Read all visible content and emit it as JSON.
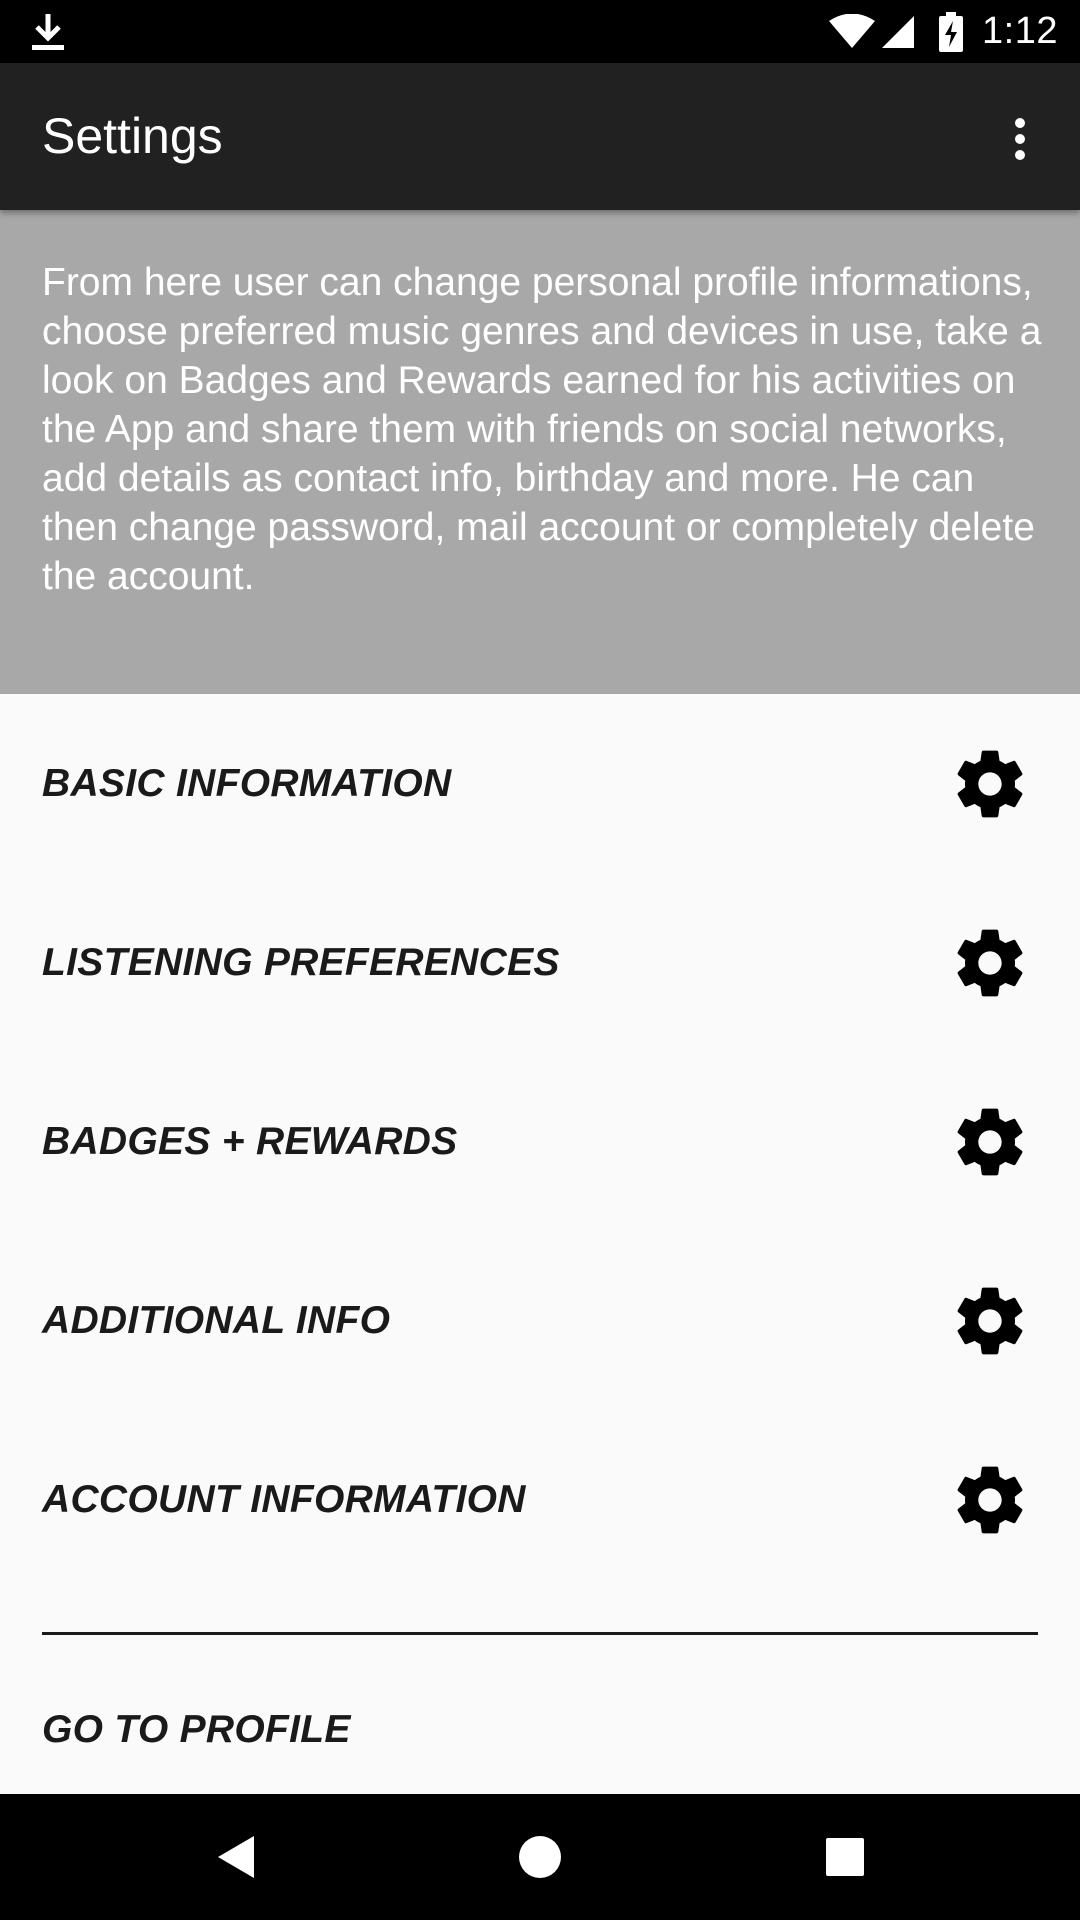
{
  "status_bar": {
    "time": "1:12",
    "icons": [
      "download-icon",
      "wifi-icon",
      "signal-icon",
      "battery-charging-icon"
    ]
  },
  "app_bar": {
    "title": "Settings",
    "overflow_icon": "more-vert-icon"
  },
  "description": "From here user can change personal profile informations, choose preferred music genres and devices in use, take a look on Badges and Rewards earned for his activities on the App and share them with friends on social networks, add details as contact info, birthday and more. He can then change password, mail account or completely delete the account.",
  "settings": {
    "items": [
      {
        "label": "BASIC INFORMATION",
        "icon": "gear-icon"
      },
      {
        "label": "LISTENING PREFERENCES",
        "icon": "gear-icon"
      },
      {
        "label": "BADGES + REWARDS",
        "icon": "gear-icon"
      },
      {
        "label": "ADDITIONAL INFO",
        "icon": "gear-icon"
      },
      {
        "label": "ACCOUNT INFORMATION",
        "icon": "gear-icon"
      }
    ],
    "profile_link": "GO TO PROFILE"
  },
  "nav_bar": {
    "icons": [
      "back-icon",
      "home-icon",
      "recents-icon"
    ]
  },
  "colors": {
    "status_bar": "#000000",
    "app_bar": "#212121",
    "description_bg": "#a8a8a8",
    "list_bg": "#fafafa",
    "text_dark": "#1a1a1a"
  }
}
